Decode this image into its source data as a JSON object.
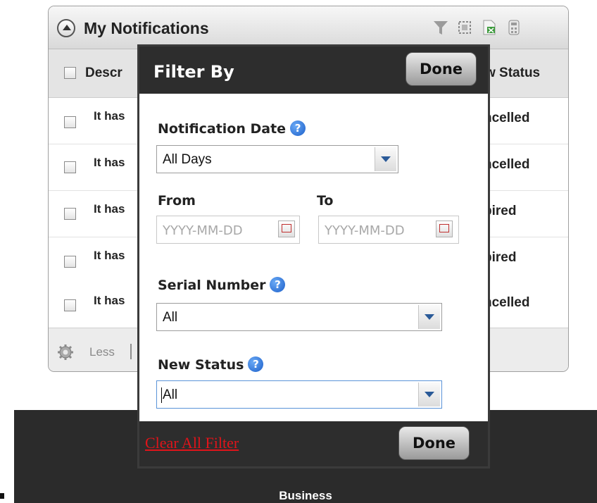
{
  "widget": {
    "title": "My Notifications",
    "columns": {
      "description": "Descr",
      "new_status": "w Status"
    },
    "rows": [
      {
        "description": "It has",
        "status": "ncelled"
      },
      {
        "description": "It has",
        "status": "ncelled"
      },
      {
        "description": "It has",
        "status": "pired"
      },
      {
        "description": "It has",
        "status": "pired"
      },
      {
        "description": "It has",
        "status": "ncelled"
      }
    ],
    "footer": {
      "less_label": "Less"
    },
    "header_icons": [
      "filter-icon",
      "column-chooser-icon",
      "excel-export-icon",
      "calculator-icon"
    ]
  },
  "filter": {
    "title": "Filter By",
    "done_label": "Done",
    "notification_date": {
      "label": "Notification Date",
      "value": "All Days"
    },
    "from": {
      "label": "From",
      "placeholder": "YYYY-MM-DD"
    },
    "to": {
      "label": "To",
      "placeholder": "YYYY-MM-DD"
    },
    "serial_number": {
      "label": "Serial Number",
      "value": "All"
    },
    "new_status": {
      "label": "New Status",
      "value": "All"
    },
    "clear_label": "Clear All Filter",
    "help_glyph": "?"
  },
  "footer_band": {
    "business_label": "Business"
  },
  "colors": {
    "dark_bar": "#2d2d2d",
    "link_red": "#e0141a",
    "help_blue": "#1c5fc9"
  }
}
